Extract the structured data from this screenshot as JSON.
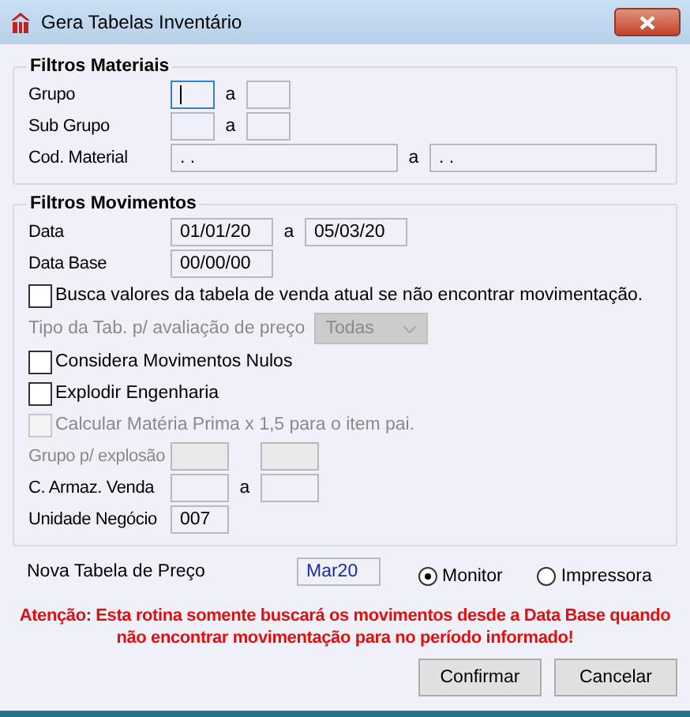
{
  "window": {
    "title": "Gera Tabelas Inventário"
  },
  "materials": {
    "title": "Filtros Materiais",
    "rows": [
      {
        "kind": "small_range",
        "label": "Grupo",
        "disabled": false,
        "from": {
          "focused": true
        },
        "sep": "a",
        "to": {
          "focused": false
        }
      },
      {
        "kind": "small_range",
        "label": "Sub Grupo",
        "disabled": false,
        "from": {
          "focused": false
        },
        "sep": "a",
        "to": {
          "focused": false
        }
      },
      {
        "kind": "long_range",
        "label": "Cod. Material",
        "disabled": false,
        "from": {
          "value": ". .",
          "focused": false
        },
        "sep": "a",
        "to": {
          "value": ". .",
          "focused": false
        }
      }
    ]
  },
  "movements": {
    "title": "Filtros Movimentos",
    "rows": [
      {
        "kind": "date_range",
        "label": "Data",
        "disabled": false,
        "from": {
          "value": "01/01/20",
          "focused": false
        },
        "sep": "a",
        "to": {
          "value": "05/03/20",
          "focused": false
        }
      },
      {
        "kind": "date_range",
        "label": "Data Base",
        "disabled": false,
        "from": {
          "value": "00/00/00",
          "focused": false
        }
      },
      {
        "kind": "checkbox",
        "label": "Busca valores da tabela de venda atual se não encontrar movimentação.",
        "checked": false,
        "disabled": false
      },
      {
        "kind": "select",
        "label": "Tipo da Tab. p/ avaliação de preço",
        "value": "Todas",
        "disabled": true
      },
      {
        "kind": "checkbox",
        "label": "Considera Movimentos Nulos",
        "checked": false,
        "disabled": false
      },
      {
        "kind": "checkbox",
        "label": "Explodir Engenharia",
        "checked": false,
        "disabled": false
      },
      {
        "kind": "checkbox",
        "label": "Calcular Matéria Prima x 1,5 para o item pai.",
        "checked": false,
        "disabled": true
      },
      {
        "kind": "medium_range",
        "label": "Grupo p/ explosão",
        "disabled": true,
        "from": {
          "focused": false
        },
        "to": {
          "focused": false
        }
      },
      {
        "kind": "medium_range",
        "label": "C. Armaz. Venda",
        "disabled": false,
        "from": {
          "focused": false
        },
        "sep": "a",
        "to": {
          "focused": false
        }
      },
      {
        "kind": "medium_range",
        "label": "Unidade Negócio",
        "disabled": false,
        "from": {
          "value": "007",
          "focused": false
        }
      }
    ]
  },
  "new_table": {
    "label": "Nova Tabela de Preço",
    "value": "Mar20"
  },
  "output": [
    {
      "label": "Monitor",
      "selected": true
    },
    {
      "label": "Impressora",
      "selected": false
    }
  ],
  "warning": "Atenção: Esta rotina somente buscará os movimentos desde a Data Base quando não encontrar movimentação para no período informado!",
  "buttons": [
    "Confirmar",
    "Cancelar"
  ]
}
